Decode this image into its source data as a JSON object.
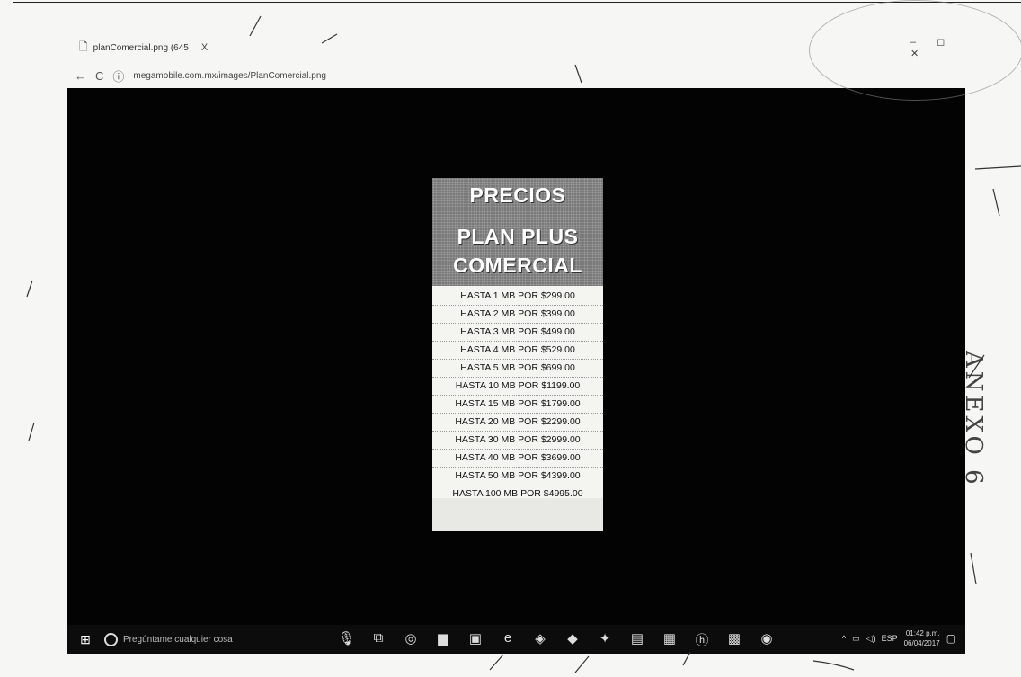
{
  "browser": {
    "tab_title": "planComercial.png (645",
    "tab_close": "X",
    "url": "megamobile.com.mx/images/PlanComercial.png"
  },
  "poster": {
    "header": [
      "PRECIOS",
      "PLAN PLUS",
      "COMERCIAL"
    ],
    "prices": [
      "HASTA 1 MB POR $299.00",
      "HASTA 2 MB POR $399.00",
      "HASTA 3 MB POR $499.00",
      "HASTA 4 MB POR $529.00",
      "HASTA 5 MB POR $699.00",
      "HASTA 10 MB POR $1199.00",
      "HASTA 15 MB POR $1799.00",
      "HASTA 20 MB POR $2299.00",
      "HASTA 30 MB POR $2999.00",
      "HASTA 40 MB POR $3699.00",
      "HASTA 50 MB POR $4399.00",
      "HASTA 100 MB POR $4995.00"
    ]
  },
  "taskbar": {
    "search_placeholder": "Pregúntame cualquier cosa",
    "icons": [
      "mic-icon",
      "task-view-icon",
      "chrome-icon",
      "folder-icon",
      "store-icon",
      "edge-icon",
      "app-icon",
      "app-icon",
      "app-icon",
      "app-icon",
      "calculator-icon",
      "hp-icon",
      "app-icon",
      "app-icon"
    ],
    "language": "ESP",
    "time": "01:42 p.m.",
    "date": "06/04/2017"
  },
  "annotations": {
    "side_note": "ANEXO 6"
  }
}
